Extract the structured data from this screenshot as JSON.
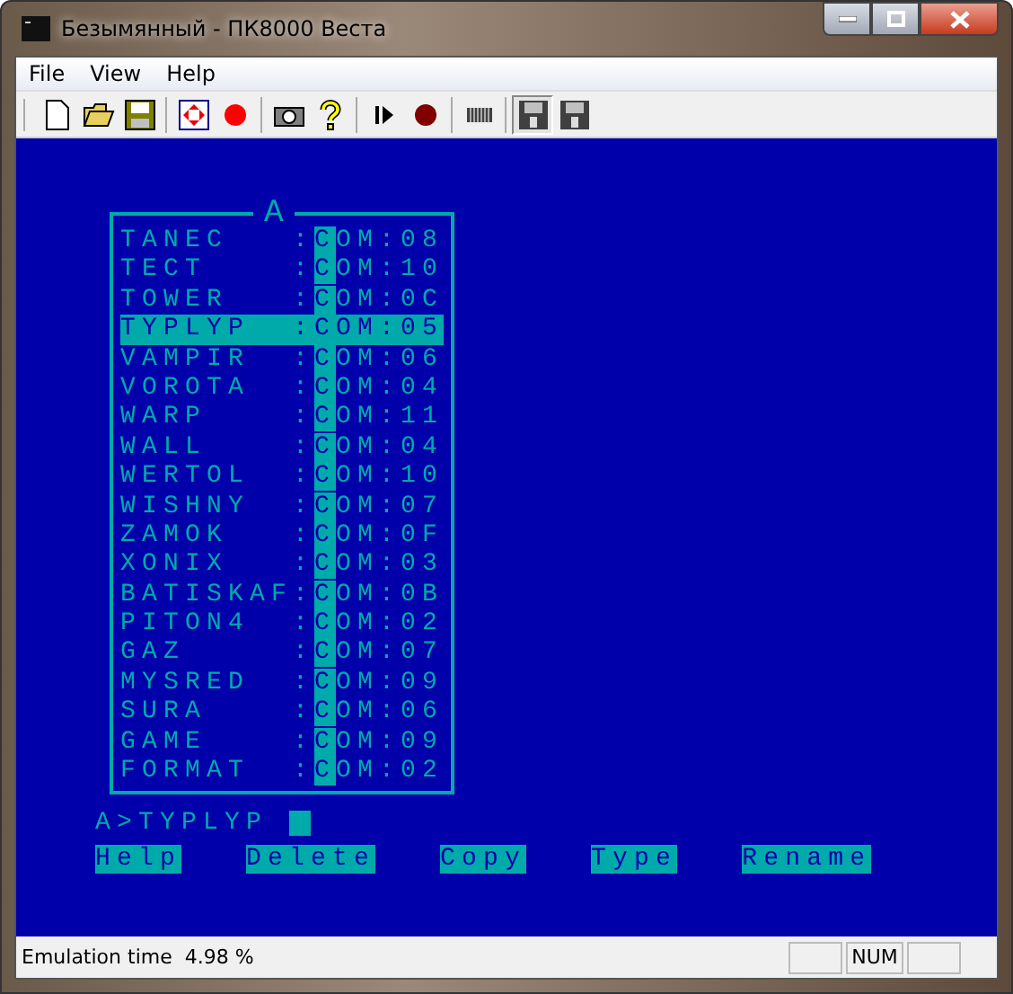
{
  "window": {
    "title": "Безымянный - ПК8000 Веста"
  },
  "menu": [
    "File",
    "View",
    "Help"
  ],
  "toolbar": [
    {
      "kind": "new",
      "pressed": false
    },
    {
      "kind": "open",
      "pressed": false
    },
    {
      "kind": "save",
      "pressed": false
    },
    {
      "kind": "sep"
    },
    {
      "kind": "fullscreen",
      "pressed": false
    },
    {
      "kind": "record",
      "pressed": false
    },
    {
      "kind": "sep"
    },
    {
      "kind": "camera",
      "pressed": false
    },
    {
      "kind": "help",
      "pressed": false
    },
    {
      "kind": "sep"
    },
    {
      "kind": "play",
      "pressed": false
    },
    {
      "kind": "stop",
      "pressed": false
    },
    {
      "kind": "sep"
    },
    {
      "kind": "tape",
      "pressed": false
    },
    {
      "kind": "sep"
    },
    {
      "kind": "disk1",
      "pressed": true
    },
    {
      "kind": "disk2",
      "pressed": false
    }
  ],
  "panel": {
    "title": "A",
    "files": [
      {
        "name": "TANEC",
        "ext": "COM",
        "sep": ":",
        "size": "08",
        "selected": false
      },
      {
        "name": "TECT",
        "ext": "COM",
        "sep": ":",
        "size": "10",
        "selected": false
      },
      {
        "name": "TOWER",
        "ext": "COM",
        "sep": ":",
        "size": "0C",
        "selected": false
      },
      {
        "name": "TYPLYP",
        "ext": "COM",
        "sep": ":",
        "size": "05",
        "selected": true
      },
      {
        "name": "VAMPIR",
        "ext": "COM",
        "sep": ":",
        "size": "06",
        "selected": false
      },
      {
        "name": "VOROTA",
        "ext": "COM",
        "sep": ":",
        "size": "04",
        "selected": false
      },
      {
        "name": "WARP",
        "ext": "COM",
        "sep": ":",
        "size": "11",
        "selected": false
      },
      {
        "name": "WALL",
        "ext": "COM",
        "sep": ":",
        "size": "04",
        "selected": false
      },
      {
        "name": "WERTOL",
        "ext": "COM",
        "sep": ":",
        "size": "10",
        "selected": false
      },
      {
        "name": "WISHNY",
        "ext": "COM",
        "sep": ":",
        "size": "07",
        "selected": false
      },
      {
        "name": "ZAMOK",
        "ext": "COM",
        "sep": ":",
        "size": "0F",
        "selected": false
      },
      {
        "name": "XONIX",
        "ext": "COM",
        "sep": ":",
        "size": "03",
        "selected": false
      },
      {
        "name": "BATISKAF",
        "ext": "COM",
        "sep": ":",
        "size": "0B",
        "selected": false
      },
      {
        "name": "PITON4",
        "ext": "COM",
        "sep": ":",
        "size": "02",
        "selected": false
      },
      {
        "name": "GAZ",
        "ext": "COM",
        "sep": ":",
        "size": "07",
        "selected": false
      },
      {
        "name": "MYSRED",
        "ext": "COM",
        "sep": ":",
        "size": "09",
        "selected": false
      },
      {
        "name": "SURA",
        "ext": "COM",
        "sep": ":",
        "size": "06",
        "selected": false
      },
      {
        "name": "GAME",
        "ext": "COM",
        "sep": ":",
        "size": "09",
        "selected": false
      },
      {
        "name": "FORMAT",
        "ext": "COM",
        "sep": ":",
        "size": "02",
        "selected": false
      }
    ]
  },
  "prompt": "A>TYPLYP",
  "function_keys": [
    "Help",
    "Delete",
    "Copy",
    "Type",
    "Rename"
  ],
  "status_bar": {
    "text": "Emulation time  4.98 %",
    "indicator": "NUM"
  }
}
